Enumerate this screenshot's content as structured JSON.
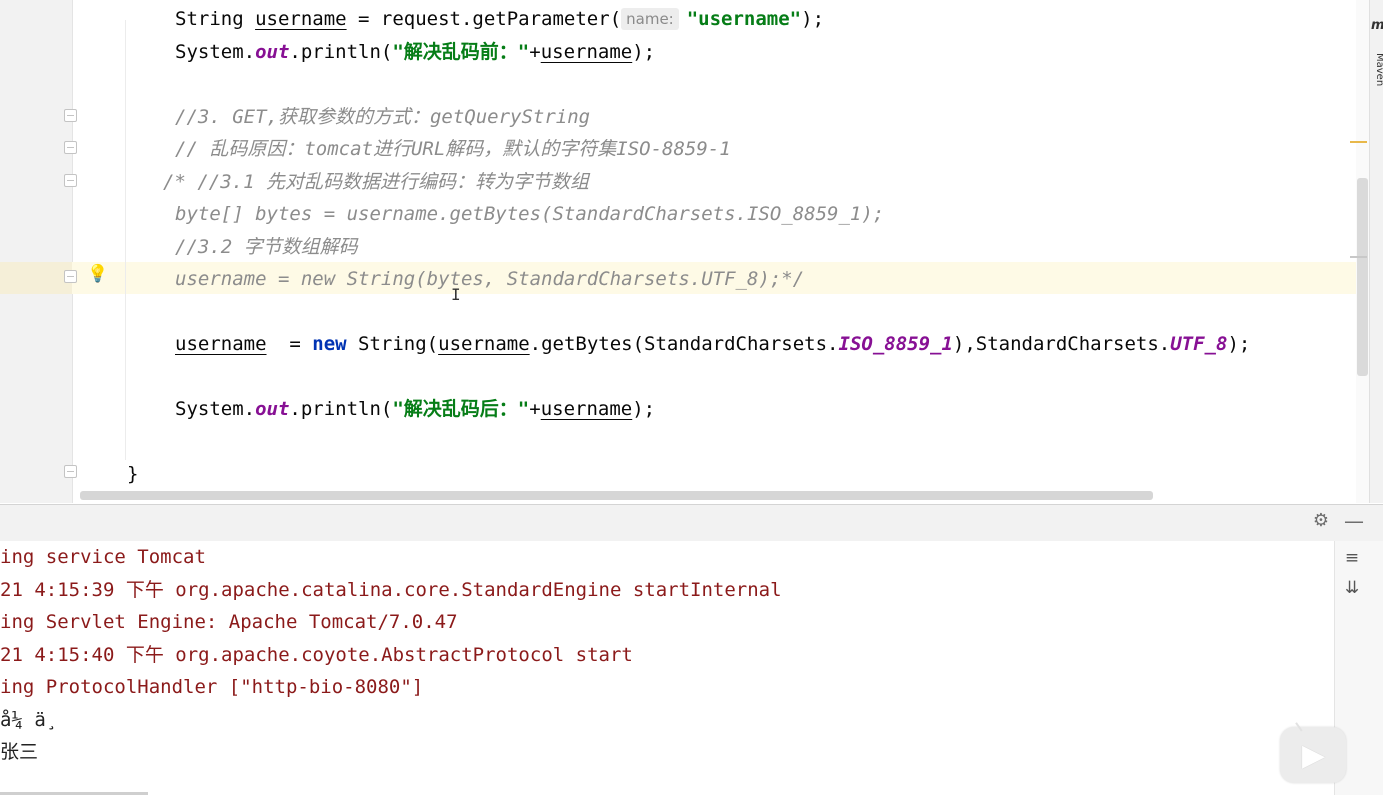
{
  "editor": {
    "lines": [
      {
        "row": 1,
        "tokens": [
          {
            "t": "String ",
            "c": ""
          },
          {
            "t": "username",
            "c": "var"
          },
          {
            "t": " = request.getParameter(",
            "c": ""
          },
          {
            "t": "name:",
            "c": "hint"
          },
          {
            "t": "\"username\"",
            "c": "str"
          },
          {
            "t": ");",
            "c": ""
          }
        ]
      },
      {
        "row": 2,
        "tokens": [
          {
            "t": "System.",
            "c": ""
          },
          {
            "t": "out",
            "c": "out"
          },
          {
            "t": ".println(",
            "c": ""
          },
          {
            "t": "\"解决乱码前：\"",
            "c": "str"
          },
          {
            "t": "+",
            "c": ""
          },
          {
            "t": "username",
            "c": "var"
          },
          {
            "t": ");",
            "c": ""
          }
        ]
      },
      {
        "row": 4,
        "tokens": [
          {
            "t": "//3. GET,获取参数的方式：getQueryString",
            "c": "cmt"
          }
        ]
      },
      {
        "row": 5,
        "tokens": [
          {
            "t": "// 乱码原因：tomcat进行URL解码，默认的字符集ISO-8859-1",
            "c": "cmt"
          }
        ]
      },
      {
        "row": 6,
        "tokens": [
          {
            "t": "/* //3.1 先对乱码数据进行编码：转为字节数组",
            "c": "cmt"
          }
        ],
        "outdent": true
      },
      {
        "row": 7,
        "tokens": [
          {
            "t": "byte[] bytes = username.getBytes(StandardCharsets.ISO_8859_1);",
            "c": "cmt"
          }
        ]
      },
      {
        "row": 8,
        "tokens": [
          {
            "t": "//3.2 字节数组解码",
            "c": "cmt"
          }
        ]
      },
      {
        "row": 9,
        "tokens": [
          {
            "t": "username = new String(bytes, StandardCharsets.UTF_8);*/",
            "c": "cmt"
          }
        ]
      },
      {
        "row": 11,
        "tokens": [
          {
            "t": "username",
            "c": "var"
          },
          {
            "t": "  = ",
            "c": ""
          },
          {
            "t": "new",
            "c": "kw"
          },
          {
            "t": " String(",
            "c": ""
          },
          {
            "t": "username",
            "c": "var"
          },
          {
            "t": ".getBytes(StandardCharsets.",
            "c": ""
          },
          {
            "t": "ISO_8859_1",
            "c": "static"
          },
          {
            "t": "),StandardCharsets.",
            "c": ""
          },
          {
            "t": "UTF_8",
            "c": "static"
          },
          {
            "t": ");",
            "c": ""
          }
        ]
      },
      {
        "row": 13,
        "tokens": [
          {
            "t": "System.",
            "c": ""
          },
          {
            "t": "out",
            "c": "out"
          },
          {
            "t": ".println(",
            "c": ""
          },
          {
            "t": "\"解决乱码后：\"",
            "c": "str"
          },
          {
            "t": "+",
            "c": ""
          },
          {
            "t": "username",
            "c": "var"
          },
          {
            "t": ");",
            "c": ""
          }
        ]
      },
      {
        "row": 15,
        "tokens": [
          {
            "t": "}",
            "c": ""
          }
        ],
        "outer": true
      }
    ],
    "side_tab_label": "Maven",
    "side_tab_icon": "m",
    "text_cursor": "I"
  },
  "console": {
    "lines": [
      {
        "text": "ing service Tomcat",
        "style": "log"
      },
      {
        "text": "21 4:15:39 下午 org.apache.catalina.core.StandardEngine startInternal",
        "style": "log"
      },
      {
        "text": "ing Servlet Engine: Apache Tomcat/7.0.47",
        "style": "log"
      },
      {
        "text": "21 4:15:40 下午 org.apache.coyote.AbstractProtocol start",
        "style": "log"
      },
      {
        "text": "ing ProtocolHandler [\"http-bio-8080\"]",
        "style": "log"
      },
      {
        "text": "å¼ ä¸",
        "style": "plain"
      },
      {
        "text": "张三",
        "style": "plain"
      }
    ],
    "header_icons": {
      "settings": "⚙",
      "minimize": "—"
    },
    "toolbar_icons": {
      "soft_wrap": "≡",
      "scroll_to_end": "⇊"
    }
  },
  "overlay": {
    "play_icon": "▶"
  }
}
